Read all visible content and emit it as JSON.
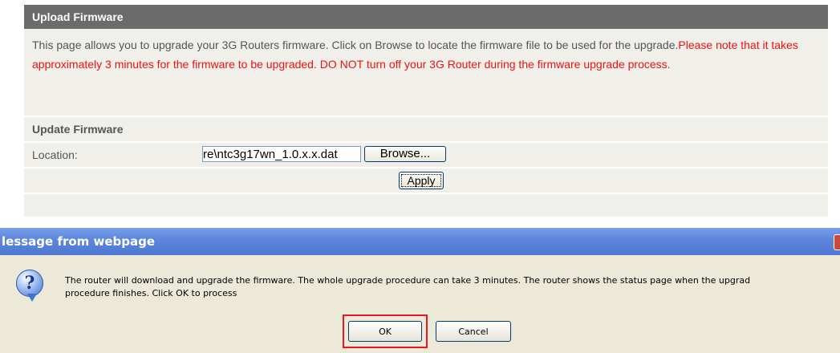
{
  "upload_panel": {
    "header": "Upload Firmware",
    "intro_text": "This page allows you to upgrade your 3G Routers firmware. Click on Browse to locate the firmware file to be used for the upgrade.",
    "warning_text": "Please note that it takes approximately 3 minutes for the firmware to be upgraded. DO NOT turn off your 3G Router during the firmware upgrade process.",
    "section_title": "Update Firmware",
    "location_label": "Location:",
    "location_value": "re\\ntc3g17wn_1.0.x.x.dat",
    "browse_label": "Browse...",
    "apply_label": "Apply"
  },
  "dialog": {
    "title": "lessage from webpage",
    "icon": "question-icon",
    "message_line1": "The router will download and upgrade the firmware. The whole upgrade procedure can take 3 minutes. The router shows the status page when the upgrad",
    "message_line2": "procedure finishes. Click OK to process",
    "ok_label": "OK",
    "cancel_label": "Cancel"
  },
  "colors": {
    "panel_header_bg": "#6b6b6b",
    "panel_bg": "#f0efea",
    "warning": "#ee1111",
    "dialog_title_bg": "#5d86dc",
    "dialog_body_bg": "#ece9d8",
    "highlight": "#e8161d"
  }
}
